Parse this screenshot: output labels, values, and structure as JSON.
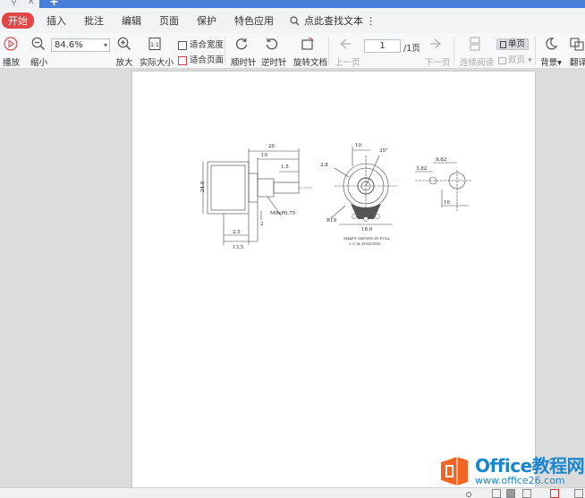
{
  "app": {
    "tab_icons": "⚲ ✕",
    "new_tab": "+"
  },
  "menu": {
    "start": "开始",
    "items": [
      "插入",
      "批注",
      "编辑",
      "页面",
      "保护",
      "特色应用"
    ],
    "search_label": "点此查找文本",
    "more": "⋮"
  },
  "toolbar": {
    "play": "播放",
    "zoom_out": "缩小",
    "zoom_value": "84.6%",
    "zoom_in": "放大",
    "actual_size": "实际大小",
    "actual_size_glyph": "1:1",
    "fit_width": "适合宽度",
    "fit_page": "适合页面",
    "rotate_cw": "顺时针",
    "rotate_ccw": "逆时针",
    "rotate_doc": "旋转文档",
    "prev_page": "上一页",
    "page_number": "1",
    "page_total": "/1页",
    "next_page": "下一页",
    "continuous": "连续阅读",
    "single": "单页",
    "double": "双页",
    "background": "背景",
    "translate": "翻译"
  },
  "drawing": {
    "dims": {
      "top_width": "20",
      "inner_width": "10",
      "shaft_small": "1.5",
      "left_height": "24.8",
      "thread": "M9xP0.75",
      "step": "2",
      "bottom_small": "2.5",
      "bottom_total": "13.5",
      "angle": "35°",
      "hole_note": "2.8",
      "center_width": "10",
      "radius": "R19",
      "base_width": "18.0",
      "pin_pitch": "9.82",
      "pin_left": "3.82",
      "pin_depth": "10"
    },
    "caption_line1": "SHAFT SHOWN IN FULL",
    "caption_line2": "C.C.W. POSITION"
  },
  "watermark": {
    "title": "Office教程网",
    "url": "www.office26.com"
  },
  "colors": {
    "accent_blue": "#4a7fd8",
    "start_red": "#e04848",
    "watermark_blue": "#1a86d0",
    "watermark_orange": "#f26522"
  }
}
